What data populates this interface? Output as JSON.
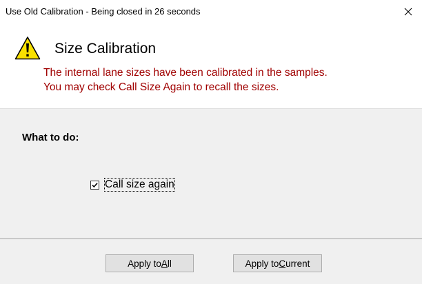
{
  "window": {
    "title": "Use Old Calibration - Being closed in 26 seconds"
  },
  "header": {
    "title": "Size Calibration",
    "icon": "warning-icon",
    "message_lines": [
      "The internal lane sizes have been calibrated in the samples.",
      "You may check Call Size Again to recall the sizes."
    ],
    "message_color": "#a00000"
  },
  "content": {
    "group_label": "What to do:",
    "checkbox": {
      "label": "Call size again",
      "checked": true
    }
  },
  "buttons": {
    "apply_all": {
      "label_before": "Apply to ",
      "mnemonic": "A",
      "label_after": "ll"
    },
    "apply_current": {
      "label_before": "Apply to ",
      "mnemonic": "C",
      "label_after": "urrent"
    }
  }
}
